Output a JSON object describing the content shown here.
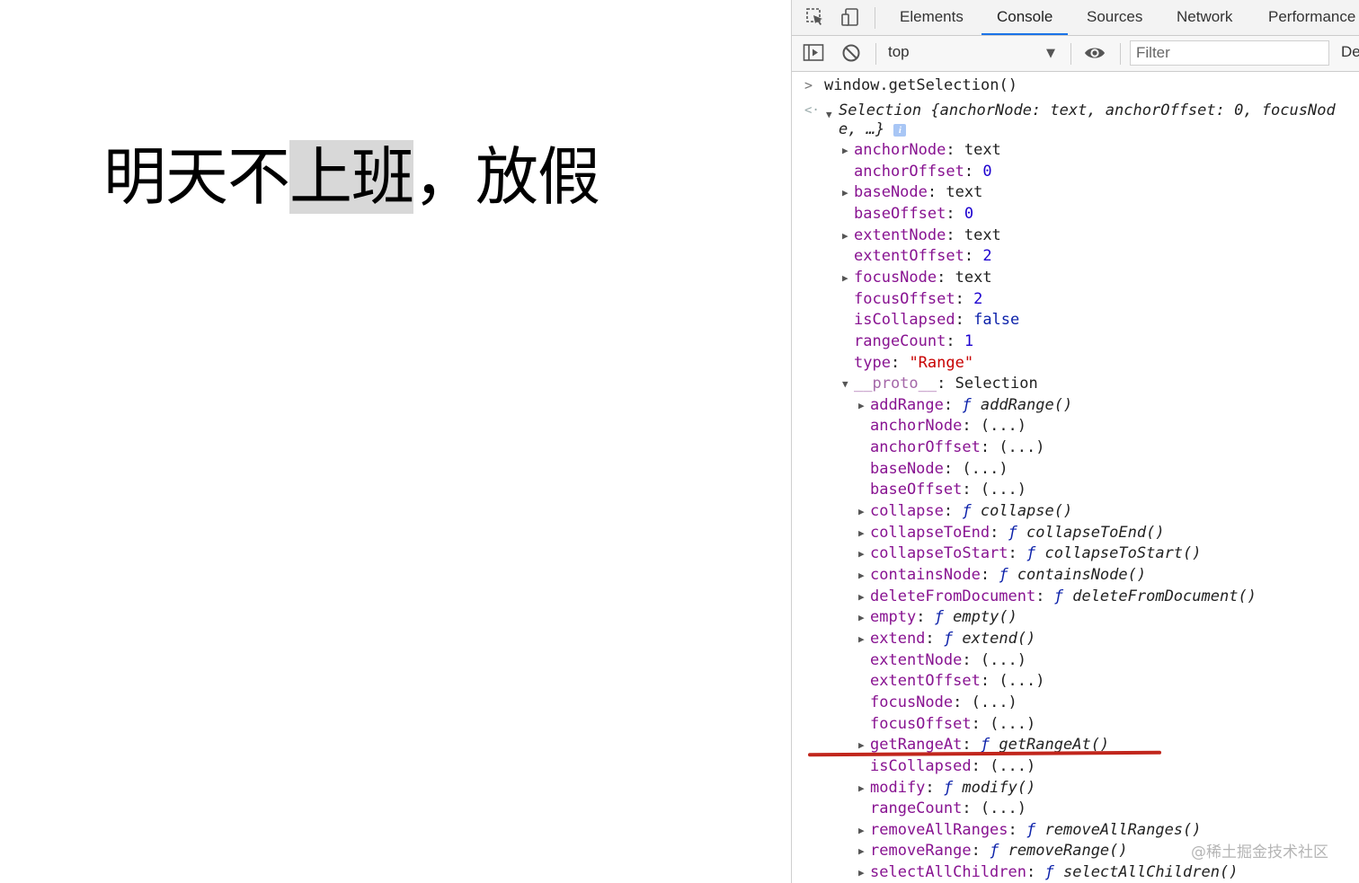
{
  "page": {
    "before_selection": "明天不",
    "selected": "上班",
    "after_selection": "，放假"
  },
  "devtools": {
    "tabs": [
      "Elements",
      "Console",
      "Sources",
      "Network",
      "Performance"
    ],
    "active_tab": "Console",
    "context": "top",
    "filter_placeholder": "Filter",
    "levels_label": "De",
    "accent_color": "#1a73e8"
  },
  "console": {
    "command": "window.getSelection()",
    "summary_line1": "Selection {anchorNode: text, anchorOffset: 0, focusNod",
    "summary_line2": "e, …}",
    "properties": [
      {
        "indent": 1,
        "expandable": true,
        "key": "anchorNode",
        "value": "text",
        "vtype": "plain"
      },
      {
        "indent": 1,
        "expandable": false,
        "key": "anchorOffset",
        "value": "0",
        "vtype": "num"
      },
      {
        "indent": 1,
        "expandable": true,
        "key": "baseNode",
        "value": "text",
        "vtype": "plain"
      },
      {
        "indent": 1,
        "expandable": false,
        "key": "baseOffset",
        "value": "0",
        "vtype": "num"
      },
      {
        "indent": 1,
        "expandable": true,
        "key": "extentNode",
        "value": "text",
        "vtype": "plain"
      },
      {
        "indent": 1,
        "expandable": false,
        "key": "extentOffset",
        "value": "2",
        "vtype": "num"
      },
      {
        "indent": 1,
        "expandable": true,
        "key": "focusNode",
        "value": "text",
        "vtype": "plain"
      },
      {
        "indent": 1,
        "expandable": false,
        "key": "focusOffset",
        "value": "2",
        "vtype": "num"
      },
      {
        "indent": 1,
        "expandable": false,
        "key": "isCollapsed",
        "value": "false",
        "vtype": "kw"
      },
      {
        "indent": 1,
        "expandable": false,
        "key": "rangeCount",
        "value": "1",
        "vtype": "num"
      },
      {
        "indent": 1,
        "expandable": false,
        "key": "type",
        "value": "\"Range\"",
        "vtype": "str"
      },
      {
        "indent": 1,
        "expandable": true,
        "expanded": true,
        "key": "__proto__",
        "value": "Selection",
        "vtype": "plain",
        "proto": true
      },
      {
        "indent": 2,
        "expandable": true,
        "key": "addRange",
        "value": "addRange()",
        "vtype": "fn"
      },
      {
        "indent": 2,
        "expandable": false,
        "key": "anchorNode",
        "value": "(...)",
        "vtype": "plain"
      },
      {
        "indent": 2,
        "expandable": false,
        "key": "anchorOffset",
        "value": "(...)",
        "vtype": "plain"
      },
      {
        "indent": 2,
        "expandable": false,
        "key": "baseNode",
        "value": "(...)",
        "vtype": "plain"
      },
      {
        "indent": 2,
        "expandable": false,
        "key": "baseOffset",
        "value": "(...)",
        "vtype": "plain"
      },
      {
        "indent": 2,
        "expandable": true,
        "key": "collapse",
        "value": "collapse()",
        "vtype": "fn"
      },
      {
        "indent": 2,
        "expandable": true,
        "key": "collapseToEnd",
        "value": "collapseToEnd()",
        "vtype": "fn"
      },
      {
        "indent": 2,
        "expandable": true,
        "key": "collapseToStart",
        "value": "collapseToStart()",
        "vtype": "fn"
      },
      {
        "indent": 2,
        "expandable": true,
        "key": "containsNode",
        "value": "containsNode()",
        "vtype": "fn"
      },
      {
        "indent": 2,
        "expandable": true,
        "key": "deleteFromDocument",
        "value": "deleteFromDocument()",
        "vtype": "fn"
      },
      {
        "indent": 2,
        "expandable": true,
        "key": "empty",
        "value": "empty()",
        "vtype": "fn"
      },
      {
        "indent": 2,
        "expandable": true,
        "key": "extend",
        "value": "extend()",
        "vtype": "fn"
      },
      {
        "indent": 2,
        "expandable": false,
        "key": "extentNode",
        "value": "(...)",
        "vtype": "plain"
      },
      {
        "indent": 2,
        "expandable": false,
        "key": "extentOffset",
        "value": "(...)",
        "vtype": "plain"
      },
      {
        "indent": 2,
        "expandable": false,
        "key": "focusNode",
        "value": "(...)",
        "vtype": "plain"
      },
      {
        "indent": 2,
        "expandable": false,
        "key": "focusOffset",
        "value": "(...)",
        "vtype": "plain"
      },
      {
        "indent": 2,
        "expandable": true,
        "key": "getRangeAt",
        "value": "getRangeAt()",
        "vtype": "fn"
      },
      {
        "indent": 2,
        "expandable": false,
        "key": "isCollapsed",
        "value": "(...)",
        "vtype": "plain"
      },
      {
        "indent": 2,
        "expandable": true,
        "key": "modify",
        "value": "modify()",
        "vtype": "fn"
      },
      {
        "indent": 2,
        "expandable": false,
        "key": "rangeCount",
        "value": "(...)",
        "vtype": "plain"
      },
      {
        "indent": 2,
        "expandable": true,
        "key": "removeAllRanges",
        "value": "removeAllRanges()",
        "vtype": "fn"
      },
      {
        "indent": 2,
        "expandable": true,
        "key": "removeRange",
        "value": "removeRange()",
        "vtype": "fn"
      },
      {
        "indent": 2,
        "expandable": true,
        "key": "selectAllChildren",
        "value": "selectAllChildren()",
        "vtype": "fn"
      }
    ],
    "fn_marker": "ƒ",
    "highlight_color": "#c1261c"
  },
  "watermark": "@稀土掘金技术社区"
}
